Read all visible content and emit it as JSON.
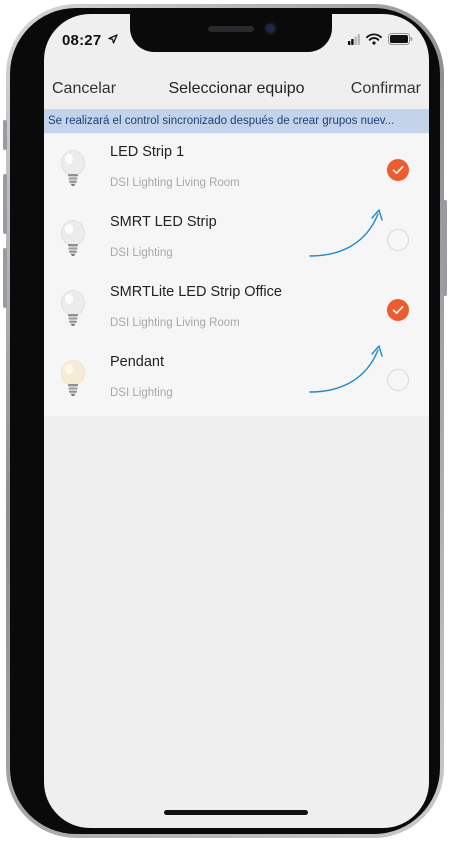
{
  "status": {
    "time": "08:27"
  },
  "nav": {
    "cancel": "Cancelar",
    "title": "Seleccionar equipo",
    "confirm": "Confirmar"
  },
  "banner": {
    "text": "Se realizará el control sincronizado después de crear grupos nuev..."
  },
  "devices": [
    {
      "name": "LED Strip 1",
      "room": "DSI Lighting Living Room",
      "selected": true
    },
    {
      "name": "SMRT LED Strip",
      "room": "DSI Lighting",
      "selected": false
    },
    {
      "name": "SMRTLite LED Strip Office",
      "room": "DSI Lighting Living Room",
      "selected": true
    },
    {
      "name": "Pendant",
      "room": "DSI Lighting",
      "selected": false
    }
  ],
  "colors": {
    "accent": "#ee5c2e",
    "banner_bg": "#c3d3ea",
    "banner_text": "#1f3f7a",
    "annotation_arrow": "#1c8bd0"
  },
  "icons": {
    "bulb": "light-bulb-icon",
    "check": "checkmark-icon",
    "wifi": "wifi-icon",
    "battery": "battery-icon",
    "location": "location-arrow-icon",
    "signal": "cellular-signal-icon"
  }
}
